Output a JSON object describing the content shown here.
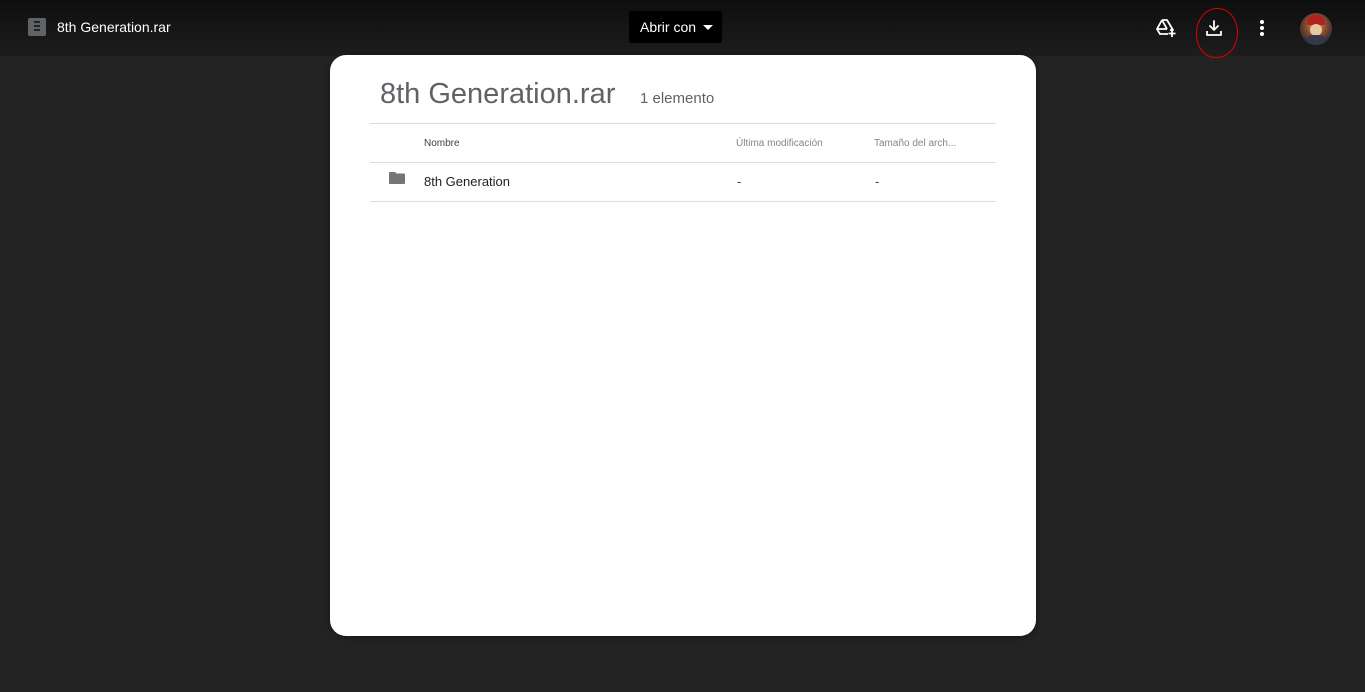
{
  "topbar": {
    "file_icon": "archive-file-icon",
    "file_title": "8th Generation.rar",
    "open_with_label": "Abrir con",
    "add_to_drive_icon": "add-to-drive-icon",
    "download_icon": "download-icon",
    "more_icon": "more-vert-icon",
    "annotation_color": "#e00000"
  },
  "panel": {
    "title": "8th Generation.rar",
    "item_count": "1 elemento",
    "columns": {
      "name": "Nombre",
      "modified": "Última modificación",
      "size": "Tamaño del arch..."
    },
    "rows": [
      {
        "icon": "folder-icon",
        "name": "8th Generation",
        "modified": "-",
        "size": "-"
      }
    ]
  },
  "colors": {
    "background": "#232323",
    "panel": "#ffffff",
    "text_muted": "#5f6368"
  }
}
